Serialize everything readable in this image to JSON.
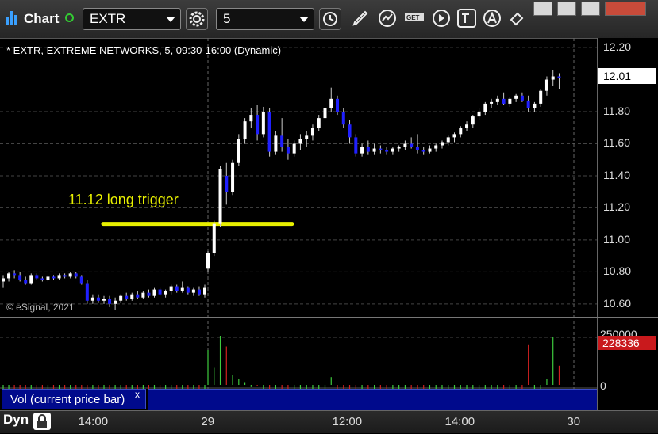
{
  "toolbar": {
    "title": "Chart",
    "symbol": "EXTR",
    "interval": "5",
    "icons": [
      "gear-icon",
      "clock-icon",
      "pencil-icon",
      "indicator-icon",
      "get-icon",
      "play-icon",
      "text-icon",
      "alert-icon",
      "link-icon"
    ]
  },
  "window_buttons": [
    "minimize",
    "restore",
    "maximize",
    "close"
  ],
  "chart_header": "* EXTR, EXTREME NETWORKS, 5, 09:30-16:00 (Dynamic)",
  "copyright": "© eSignal, 2021",
  "annotation": {
    "text": "11.12 long trigger",
    "price": 11.1,
    "color": "#e8f000"
  },
  "study": {
    "label": "Vol (current price bar)",
    "close_symbol": "x"
  },
  "footer": {
    "mode": "Dyn"
  },
  "colors": {
    "up": "#ffffff",
    "down": "#2020ff",
    "vol_up": "#3ecb3e",
    "vol_down": "#d02020",
    "annotation": "#e8f000",
    "last_price_flag": "#ffffff",
    "volume_flag": "#c9191c"
  },
  "chart_data": {
    "type": "candlestick",
    "title": "* EXTR, EXTREME NETWORKS, 5, 09:30-16:00 (Dynamic)",
    "price_axis": {
      "min": 10.52,
      "max": 12.24,
      "ticks": [
        "12.20",
        "11.80",
        "11.60",
        "11.40",
        "11.20",
        "11.00",
        "10.80",
        "10.60"
      ]
    },
    "last_price": "12.01",
    "volume_axis": {
      "ticks": [
        "0"
      ],
      "partial_top_label": "250000",
      "last_volume": "228336"
    },
    "time_labels": [
      "14:00",
      "29",
      "12:00",
      "14:00",
      "30"
    ],
    "session_breaks": [
      "29",
      "30"
    ],
    "legend": "none",
    "grid": true,
    "candles": [
      [
        10.74,
        10.78,
        10.7,
        10.76
      ],
      [
        10.76,
        10.8,
        10.74,
        10.79
      ],
      [
        10.79,
        10.81,
        10.76,
        10.78
      ],
      [
        10.78,
        10.8,
        10.74,
        10.75
      ],
      [
        10.75,
        10.77,
        10.72,
        10.73
      ],
      [
        10.73,
        10.79,
        10.72,
        10.78
      ],
      [
        10.78,
        10.79,
        10.75,
        10.76
      ],
      [
        10.76,
        10.77,
        10.74,
        10.75
      ],
      [
        10.75,
        10.78,
        10.74,
        10.77
      ],
      [
        10.77,
        10.78,
        10.75,
        10.76
      ],
      [
        10.76,
        10.79,
        10.75,
        10.78
      ],
      [
        10.78,
        10.79,
        10.76,
        10.77
      ],
      [
        10.77,
        10.8,
        10.76,
        10.79
      ],
      [
        10.79,
        10.8,
        10.76,
        10.77
      ],
      [
        10.77,
        10.78,
        10.72,
        10.73
      ],
      [
        10.73,
        10.75,
        10.6,
        10.62
      ],
      [
        10.62,
        10.66,
        10.6,
        10.64
      ],
      [
        10.64,
        10.66,
        10.61,
        10.62
      ],
      [
        10.62,
        10.65,
        10.6,
        10.63
      ],
      [
        10.63,
        10.65,
        10.58,
        10.6
      ],
      [
        10.6,
        10.64,
        10.56,
        10.62
      ],
      [
        10.62,
        10.66,
        10.61,
        10.65
      ],
      [
        10.65,
        10.67,
        10.62,
        10.63
      ],
      [
        10.63,
        10.67,
        10.62,
        10.66
      ],
      [
        10.66,
        10.68,
        10.63,
        10.64
      ],
      [
        10.64,
        10.68,
        10.63,
        10.67
      ],
      [
        10.67,
        10.69,
        10.64,
        10.65
      ],
      [
        10.65,
        10.7,
        10.64,
        10.69
      ],
      [
        10.69,
        10.7,
        10.65,
        10.66
      ],
      [
        10.66,
        10.69,
        10.64,
        10.68
      ],
      [
        10.68,
        10.72,
        10.66,
        10.71
      ],
      [
        10.71,
        10.72,
        10.67,
        10.68
      ],
      [
        10.68,
        10.74,
        10.67,
        10.7
      ],
      [
        10.7,
        10.71,
        10.66,
        10.67
      ],
      [
        10.67,
        10.7,
        10.65,
        10.69
      ],
      [
        10.69,
        10.71,
        10.65,
        10.66
      ],
      [
        10.66,
        10.72,
        10.64,
        10.7
      ],
      [
        10.82,
        10.93,
        10.8,
        10.92
      ],
      [
        10.92,
        11.12,
        10.9,
        11.1
      ],
      [
        11.1,
        11.46,
        11.08,
        11.44
      ],
      [
        11.4,
        11.48,
        11.22,
        11.3
      ],
      [
        11.3,
        11.5,
        11.28,
        11.48
      ],
      [
        11.48,
        11.66,
        11.46,
        11.63
      ],
      [
        11.63,
        11.76,
        11.6,
        11.74
      ],
      [
        11.74,
        11.82,
        11.7,
        11.78
      ],
      [
        11.78,
        11.84,
        11.62,
        11.66
      ],
      [
        11.66,
        11.83,
        11.64,
        11.8
      ],
      [
        11.8,
        11.82,
        11.52,
        11.55
      ],
      [
        11.55,
        11.68,
        11.53,
        11.65
      ],
      [
        11.65,
        11.76,
        11.55,
        11.58
      ],
      [
        11.58,
        11.63,
        11.5,
        11.54
      ],
      [
        11.54,
        11.62,
        11.52,
        11.6
      ],
      [
        11.6,
        11.66,
        11.56,
        11.63
      ],
      [
        11.63,
        11.68,
        11.58,
        11.65
      ],
      [
        11.65,
        11.72,
        11.62,
        11.7
      ],
      [
        11.7,
        11.78,
        11.68,
        11.76
      ],
      [
        11.76,
        11.85,
        11.72,
        11.82
      ],
      [
        11.82,
        11.95,
        11.8,
        11.88
      ],
      [
        11.88,
        11.9,
        11.78,
        11.8
      ],
      [
        11.8,
        11.82,
        11.7,
        11.72
      ],
      [
        11.72,
        11.75,
        11.6,
        11.64
      ],
      [
        11.64,
        11.66,
        11.52,
        11.54
      ],
      [
        11.54,
        11.6,
        11.52,
        11.58
      ],
      [
        11.58,
        11.62,
        11.53,
        11.55
      ],
      [
        11.55,
        11.6,
        11.53,
        11.57
      ],
      [
        11.57,
        11.59,
        11.54,
        11.56
      ],
      [
        11.56,
        11.58,
        11.53,
        11.55
      ],
      [
        11.55,
        11.58,
        11.53,
        11.57
      ],
      [
        11.57,
        11.59,
        11.55,
        11.58
      ],
      [
        11.58,
        11.62,
        11.56,
        11.6
      ],
      [
        11.6,
        11.64,
        11.57,
        11.58
      ],
      [
        11.58,
        11.66,
        11.54,
        11.56
      ],
      [
        11.56,
        11.58,
        11.53,
        11.55
      ],
      [
        11.55,
        11.59,
        11.54,
        11.57
      ],
      [
        11.57,
        11.6,
        11.55,
        11.59
      ],
      [
        11.59,
        11.62,
        11.57,
        11.61
      ],
      [
        11.61,
        11.65,
        11.59,
        11.64
      ],
      [
        11.64,
        11.67,
        11.61,
        11.66
      ],
      [
        11.66,
        11.71,
        11.64,
        11.7
      ],
      [
        11.7,
        11.74,
        11.68,
        11.72
      ],
      [
        11.72,
        11.78,
        11.7,
        11.77
      ],
      [
        11.77,
        11.82,
        11.75,
        11.8
      ],
      [
        11.8,
        11.86,
        11.78,
        11.85
      ],
      [
        11.85,
        11.88,
        11.82,
        11.86
      ],
      [
        11.86,
        11.9,
        11.84,
        11.88
      ],
      [
        11.88,
        11.92,
        11.84,
        11.85
      ],
      [
        11.85,
        11.89,
        11.83,
        11.88
      ],
      [
        11.88,
        11.91,
        11.86,
        11.9
      ],
      [
        11.9,
        11.92,
        11.86,
        11.87
      ],
      [
        11.87,
        11.9,
        11.8,
        11.82
      ],
      [
        11.82,
        11.86,
        11.8,
        11.85
      ],
      [
        11.85,
        11.94,
        11.83,
        11.93
      ],
      [
        11.93,
        12.02,
        11.9,
        12.0
      ],
      [
        12.0,
        12.06,
        11.96,
        12.02
      ],
      [
        12.02,
        12.04,
        11.94,
        12.01
      ]
    ],
    "volume_ratio": [
      0.18,
      0.22,
      0.08,
      0.1,
      0.06,
      0.07,
      0.05,
      0.08,
      0.06,
      0.05,
      0.07,
      0.05,
      0.06,
      0.08,
      0.1,
      0.09,
      0.07,
      0.05,
      0.06,
      0.08,
      0.07,
      0.06,
      0.05,
      0.06,
      0.05,
      0.07,
      0.08,
      0.06,
      0.05,
      0.07,
      0.06,
      0.05,
      0.07,
      0.06,
      0.08,
      0.1,
      0.25,
      0.8,
      0.55,
      1.0,
      0.85,
      0.45,
      0.4,
      0.35,
      0.28,
      0.3,
      0.25,
      0.22,
      0.2,
      0.15,
      0.18,
      0.14,
      0.12,
      0.15,
      0.13,
      0.12,
      0.25,
      0.42,
      0.2,
      0.18,
      0.14,
      0.12,
      0.1,
      0.08,
      0.07,
      0.06,
      0.08,
      0.07,
      0.06,
      0.05,
      0.07,
      0.06,
      0.08,
      0.05,
      0.06,
      0.07,
      0.05,
      0.08,
      0.06,
      0.07,
      0.1,
      0.06,
      0.05,
      0.08,
      0.06,
      0.07,
      0.12,
      0.06,
      0.08,
      0.88,
      0.15,
      0.1,
      0.4,
      0.98,
      0.58
    ]
  }
}
